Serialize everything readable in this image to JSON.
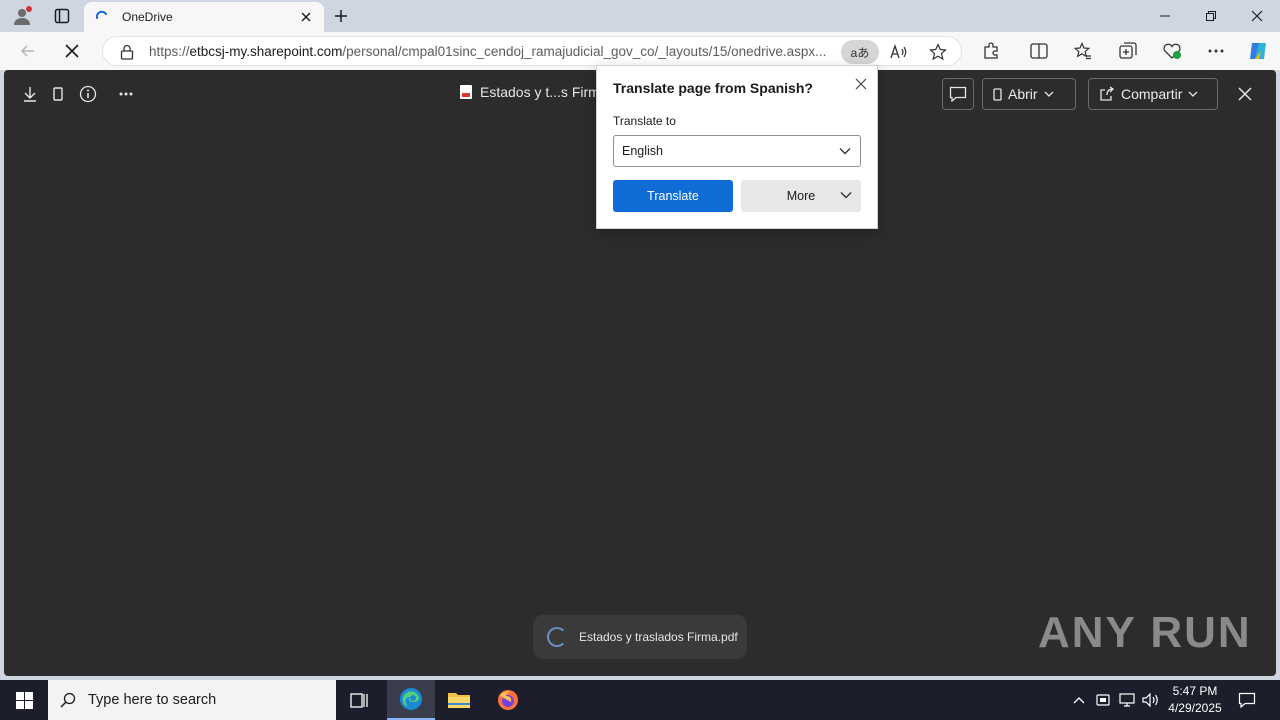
{
  "browser": {
    "tab": {
      "title": "OneDrive"
    },
    "url": {
      "prefix": "https://",
      "host": "etbcsj-my.sharepoint.com",
      "path": "/personal/cmpal01sinc_cendoj_ramajudicial_gov_co/_layouts/15/onedrive.aspx..."
    },
    "translate_chip": "aあ"
  },
  "viewer": {
    "doc_title": "Estados y t...s Firm",
    "open_button": "Abrir",
    "share_button": "Compartir",
    "toast_text": "Estados y traslados Firma.pdf",
    "watermark": "ANY RUN"
  },
  "translate_popup": {
    "title": "Translate page from Spanish?",
    "label": "Translate to",
    "selected_language": "English",
    "translate_button": "Translate",
    "more_button": "More"
  },
  "taskbar": {
    "search_placeholder": "Type here to search",
    "time": "5:47 PM",
    "date": "4/29/2025"
  },
  "colors": {
    "accent": "#0f6cd4",
    "viewer_bg": "#2c2c2c",
    "taskbar_bg": "#1c1f2b"
  }
}
